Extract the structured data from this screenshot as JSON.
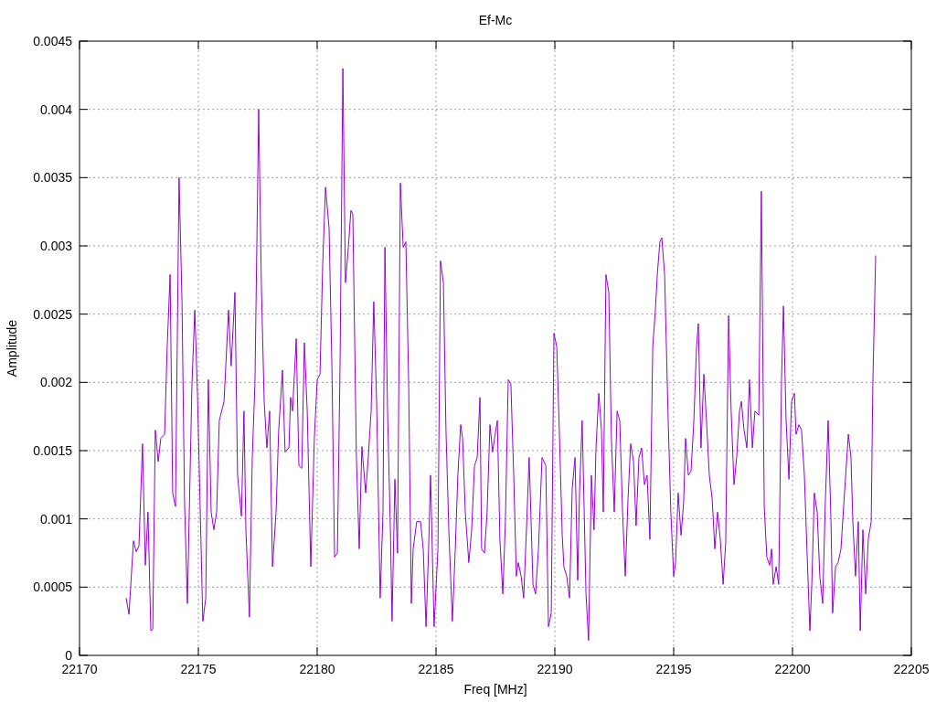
{
  "chart_data": {
    "type": "line",
    "title": "Ef-Mc",
    "xlabel": "Freq [MHz]",
    "ylabel": "Amplitude",
    "xlim": [
      22170,
      22205
    ],
    "ylim": [
      0,
      0.0045
    ],
    "grid": true,
    "xticks": [
      22170,
      22175,
      22180,
      22185,
      22190,
      22195,
      22200,
      22205
    ],
    "yticks": [
      0,
      0.0005,
      0.001,
      0.0015,
      0.002,
      0.0025,
      0.003,
      0.0035,
      0.004,
      0.0045
    ],
    "x": [
      22171.96,
      22172.08,
      22172.27,
      22172.38,
      22172.5,
      22172.65,
      22172.77,
      22172.88,
      22173.0,
      22173.08,
      22173.19,
      22173.31,
      22173.42,
      22173.58,
      22173.69,
      22173.81,
      22173.92,
      22174.04,
      22174.19,
      22174.31,
      22174.42,
      22174.54,
      22174.73,
      22174.85,
      22174.96,
      22175.08,
      22175.19,
      22175.31,
      22175.42,
      22175.54,
      22175.65,
      22175.77,
      22175.88,
      22176.08,
      22176.27,
      22176.38,
      22176.54,
      22176.65,
      22176.81,
      22176.92,
      22177.0,
      22177.15,
      22177.27,
      22177.38,
      22177.54,
      22177.65,
      22177.77,
      22177.88,
      22178.0,
      22178.12,
      22178.27,
      22178.38,
      22178.54,
      22178.65,
      22178.81,
      22178.88,
      22178.96,
      22179.12,
      22179.23,
      22179.35,
      22179.46,
      22179.58,
      22179.73,
      22179.88,
      22180.0,
      22180.12,
      22180.23,
      22180.35,
      22180.5,
      22180.62,
      22180.73,
      22180.85,
      22180.96,
      22181.08,
      22181.19,
      22181.31,
      22181.42,
      22181.5,
      22181.65,
      22181.77,
      22181.88,
      22182.04,
      22182.15,
      22182.27,
      22182.38,
      22182.5,
      22182.65,
      22182.77,
      22182.85,
      22182.96,
      22183.08,
      22183.15,
      22183.27,
      22183.38,
      22183.5,
      22183.62,
      22183.73,
      22183.85,
      22183.96,
      22184.04,
      22184.19,
      22184.35,
      22184.46,
      22184.58,
      22184.69,
      22184.77,
      22184.92,
      22185.08,
      22185.19,
      22185.31,
      22185.42,
      22185.54,
      22185.69,
      22185.81,
      22185.92,
      22186.04,
      22186.12,
      22186.23,
      22186.38,
      22186.5,
      22186.62,
      22186.73,
      22186.85,
      22186.92,
      22187.04,
      22187.15,
      22187.27,
      22187.38,
      22187.46,
      22187.58,
      22187.69,
      22187.81,
      22187.92,
      22188.04,
      22188.15,
      22188.27,
      22188.38,
      22188.46,
      22188.58,
      22188.69,
      22188.81,
      22188.92,
      22189.08,
      22189.19,
      22189.31,
      22189.46,
      22189.62,
      22189.73,
      22189.85,
      22189.96,
      22190.08,
      22190.19,
      22190.31,
      22190.38,
      22190.5,
      22190.62,
      22190.73,
      22190.85,
      22190.96,
      22191.04,
      22191.15,
      22191.31,
      22191.42,
      22191.54,
      22191.65,
      22191.73,
      22191.85,
      22191.96,
      22192.04,
      22192.15,
      22192.27,
      22192.38,
      22192.5,
      22192.62,
      22192.73,
      22192.85,
      22192.96,
      22193.08,
      22193.19,
      22193.31,
      22193.42,
      22193.54,
      22193.65,
      22193.77,
      22193.88,
      22194.0,
      22194.12,
      22194.23,
      22194.31,
      22194.42,
      22194.5,
      22194.62,
      22194.77,
      22194.88,
      22195.0,
      22195.08,
      22195.19,
      22195.31,
      22195.42,
      22195.5,
      22195.62,
      22195.73,
      22195.85,
      22195.96,
      22196.04,
      22196.15,
      22196.27,
      22196.38,
      22196.5,
      22196.62,
      22196.73,
      22196.85,
      22196.96,
      22197.08,
      22197.19,
      22197.31,
      22197.42,
      22197.54,
      22197.65,
      22197.77,
      22197.85,
      22197.96,
      22198.08,
      22198.19,
      22198.31,
      22198.42,
      22198.58,
      22198.69,
      22198.81,
      22198.92,
      22199.04,
      22199.12,
      22199.19,
      22199.31,
      22199.42,
      22199.54,
      22199.62,
      22199.73,
      22199.85,
      22199.96,
      22200.08,
      22200.15,
      22200.27,
      22200.38,
      22200.5,
      22200.62,
      22200.73,
      22200.81,
      22200.92,
      22201.04,
      22201.15,
      22201.27,
      22201.38,
      22201.5,
      22201.62,
      22201.69,
      22201.81,
      22201.92,
      22202.04,
      22202.19,
      22202.35,
      22202.46,
      22202.54,
      22202.65,
      22202.77,
      22202.85,
      22202.96,
      22203.08,
      22203.19,
      22203.31,
      22203.38,
      22203.5
    ],
    "series": [
      {
        "color": "#9400d3",
        "values": [
          0.00042,
          0.0003,
          0.00084,
          0.00076,
          0.0008,
          0.00155,
          0.00066,
          0.00105,
          0.00018,
          0.00019,
          0.00165,
          0.00142,
          0.00159,
          0.00162,
          0.00226,
          0.00279,
          0.00119,
          0.00109,
          0.0035,
          0.00259,
          0.00112,
          0.00038,
          0.00199,
          0.00253,
          0.00192,
          0.00105,
          0.00025,
          0.00042,
          0.00202,
          0.00105,
          0.00092,
          0.00105,
          0.00172,
          0.00186,
          0.00253,
          0.00212,
          0.00266,
          0.00132,
          0.00102,
          0.00179,
          0.00092,
          0.00028,
          0.00145,
          0.00199,
          0.004,
          0.00273,
          0.00186,
          0.00152,
          0.00179,
          0.00065,
          0.00105,
          0.00165,
          0.00209,
          0.00149,
          0.00152,
          0.00189,
          0.00179,
          0.00232,
          0.00139,
          0.00137,
          0.00229,
          0.00179,
          0.00065,
          0.00159,
          0.00202,
          0.00206,
          0.00286,
          0.00343,
          0.00313,
          0.00212,
          0.00072,
          0.00075,
          0.00212,
          0.0043,
          0.00273,
          0.00299,
          0.00326,
          0.00323,
          0.00145,
          0.00078,
          0.00153,
          0.00119,
          0.00145,
          0.00179,
          0.00259,
          0.00186,
          0.00042,
          0.00105,
          0.00299,
          0.00179,
          0.00092,
          0.00025,
          0.00129,
          0.00075,
          0.00346,
          0.00299,
          0.00303,
          0.00199,
          0.00038,
          0.00078,
          0.00098,
          0.00098,
          0.00078,
          0.00021,
          0.00078,
          0.00132,
          0.00021,
          0.00078,
          0.00289,
          0.00273,
          0.00165,
          0.00092,
          0.00025,
          0.00078,
          0.00132,
          0.00169,
          0.00159,
          0.00105,
          0.00068,
          0.00092,
          0.00139,
          0.00145,
          0.00189,
          0.00078,
          0.00075,
          0.00105,
          0.00169,
          0.00149,
          0.00159,
          0.00172,
          0.00085,
          0.00045,
          0.00098,
          0.00202,
          0.00199,
          0.00132,
          0.00058,
          0.00068,
          0.00058,
          0.00042,
          0.00095,
          0.00145,
          0.00052,
          0.00045,
          0.00078,
          0.00145,
          0.00139,
          0.00021,
          0.00031,
          0.00236,
          0.00226,
          0.00165,
          0.00088,
          0.00065,
          0.00058,
          0.00042,
          0.00122,
          0.00145,
          0.00055,
          0.00119,
          0.00172,
          0.00045,
          0.00011,
          0.00132,
          0.00092,
          0.00152,
          0.00192,
          0.00165,
          0.00105,
          0.00279,
          0.00266,
          0.00159,
          0.00105,
          0.00179,
          0.00172,
          0.00105,
          0.00058,
          0.00115,
          0.00155,
          0.00142,
          0.00095,
          0.00145,
          0.00152,
          0.00125,
          0.00132,
          0.00085,
          0.00226,
          0.00253,
          0.00279,
          0.00303,
          0.00306,
          0.00279,
          0.00172,
          0.00105,
          0.00058,
          0.00068,
          0.00119,
          0.00088,
          0.00112,
          0.00159,
          0.00132,
          0.00135,
          0.00172,
          0.00226,
          0.00243,
          0.00152,
          0.00206,
          0.00172,
          0.00132,
          0.00115,
          0.00078,
          0.00105,
          0.00085,
          0.00052,
          0.00082,
          0.00249,
          0.00179,
          0.00125,
          0.00145,
          0.00179,
          0.00186,
          0.00165,
          0.00152,
          0.00202,
          0.00152,
          0.00179,
          0.00176,
          0.0034,
          0.00109,
          0.00072,
          0.00066,
          0.00078,
          0.00052,
          0.00065,
          0.00052,
          0.00202,
          0.00256,
          0.00172,
          0.00129,
          0.00186,
          0.00192,
          0.00162,
          0.00169,
          0.00165,
          0.00132,
          0.00072,
          0.00018,
          0.00052,
          0.00119,
          0.00105,
          0.00058,
          0.00038,
          0.00112,
          0.00172,
          0.00098,
          0.00031,
          0.00065,
          0.00068,
          0.00078,
          0.00119,
          0.00162,
          0.00145,
          0.00098,
          0.00058,
          0.00098,
          0.00018,
          0.00092,
          0.00045,
          0.00085,
          0.00098,
          0.00199,
          0.00293
        ]
      }
    ]
  }
}
